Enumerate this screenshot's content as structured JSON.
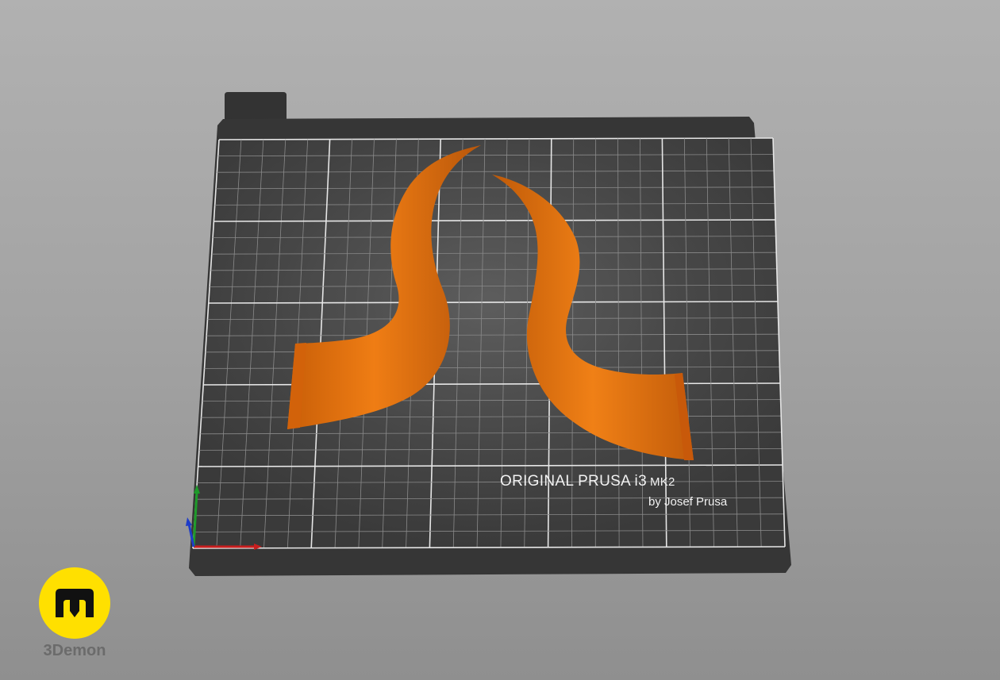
{
  "bed": {
    "brand_label": "ORIGINAL PRUSA i3",
    "model_label": "MK2",
    "maker_label": "by Josef Prusa"
  },
  "objects": [
    {
      "name": "left-horn",
      "color": "#e9730c"
    },
    {
      "name": "right-horn",
      "color": "#e9730c"
    }
  ],
  "axes": {
    "x_color": "#c81e1e",
    "y_color": "#1e9a2a",
    "z_color": "#1e3cc8"
  },
  "watermark": {
    "logo_icon": "3demon-logo-icon",
    "label": "3Demon",
    "badge_color": "#ffe000"
  }
}
